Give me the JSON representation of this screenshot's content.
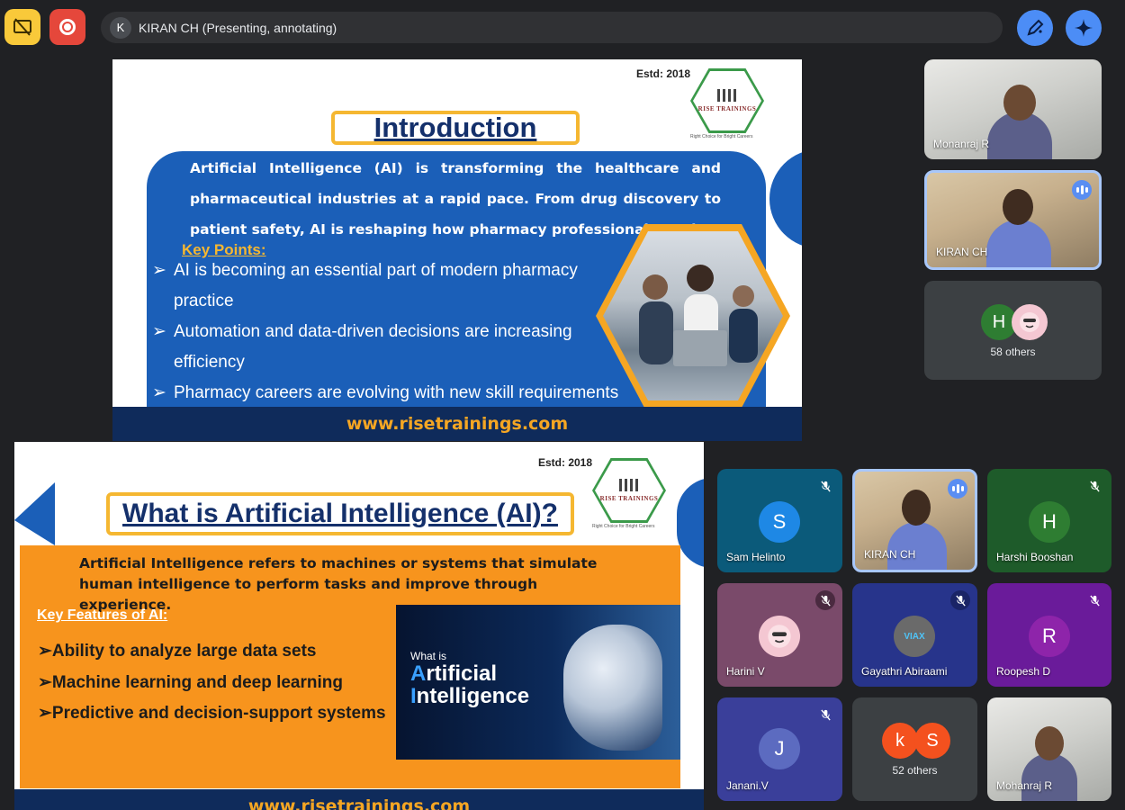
{
  "topbar": {
    "presenter_initial": "K",
    "presenter_text": "KIRAN CH (Presenting, annotating)",
    "present_icon": "stop-presenting-icon",
    "record_icon": "recording-icon",
    "annotate_icon": "pen-annotate-icon",
    "gemini_icon": "gemini-sparkle-icon"
  },
  "slide1": {
    "estd": "Estd: 2018",
    "logo_text": "RISE TRAININGS",
    "logo_tag": "Right Choice for Bright Careers",
    "title": "Introduction",
    "paragraph": "Artificial Intelligence (AI) is transforming the healthcare and pharmaceutical industries at a rapid pace. From drug discovery to patient safety, AI is reshaping how pharmacy professionals work.",
    "key_points_label": "Key Points:",
    "bullets": [
      {
        "line1": "AI is becoming an essential part of modern pharmacy",
        "line2": "practice"
      },
      {
        "line1": "Automation and data-driven decisions are increasing",
        "line2": "efficiency"
      },
      {
        "line1": "Pharmacy careers are evolving with new skill requirements",
        "line2": ""
      }
    ],
    "footer": "www.risetrainings.com"
  },
  "slide2": {
    "estd": "Estd: 2018",
    "logo_text": "RISE TRAININGS",
    "logo_tag": "Right Choice for Bright Careers",
    "title": "What is Artificial Intelligence (AI)?",
    "paragraph": "Artificial Intelligence refers to machines or systems that simulate human intelligence to perform tasks and improve through experience.",
    "key_features_label": "Key Features of AI:",
    "bullets": [
      "➢Ability to analyze large data sets",
      "➢Machine learning and deep learning",
      "➢Predictive and decision-support systems"
    ],
    "image_small": "What is",
    "image_big_1_cap": "A",
    "image_big_1_rest": "rtificial",
    "image_big_2_cap": "I",
    "image_big_2_rest": "ntelligence",
    "footer": "www.risetrainings.com"
  },
  "participants": {
    "monanraj_top": "Monanraj R",
    "kiran_top": "KIRAN CH",
    "others_top_initial": "H",
    "others_top": "58 others",
    "sam": {
      "initial": "S",
      "name": "Sam Helinto"
    },
    "kiran_mid": "KIRAN CH",
    "harshi": {
      "initial": "H",
      "name": "Harshi Booshan"
    },
    "harini": {
      "name": "Harini V"
    },
    "gayathri": {
      "avatar_text": "VIAX",
      "name": "Gayathri Abiraami"
    },
    "roopesh": {
      "initial": "R",
      "name": "Roopesh D"
    },
    "janani": {
      "initial": "J",
      "name": "Janani.V"
    },
    "others_bottom": {
      "initial_1": "k",
      "initial_2": "S",
      "label": "52 others"
    },
    "monanraj_bottom": "Mohanraj R"
  },
  "colors": {
    "background": "#202124",
    "present_yellow": "#f9c93a",
    "record_red": "#e5473b",
    "accent_blue": "#4c8df6",
    "slide_blue": "#1b5fb8",
    "slide_orange": "#f7941d"
  }
}
